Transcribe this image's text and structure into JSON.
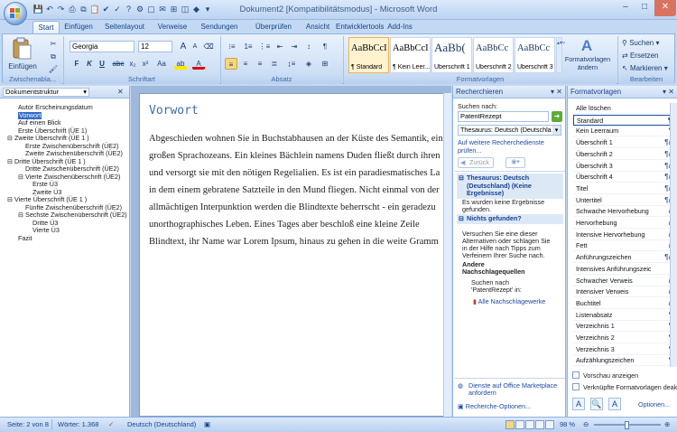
{
  "window": {
    "title": "Dokument2 [Kompatibilitätsmodus] - Microsoft Word",
    "minimize": "–",
    "maximize": "□",
    "close": "✕"
  },
  "qat": [
    "save-icon",
    "undo-icon",
    "redo-icon",
    "print-icon",
    "copy-icon",
    "paste-icon",
    "check-icon",
    "spell-icon",
    "help-icon",
    "format-icon",
    "new-icon",
    "mail-icon",
    "table-icon",
    "preview-icon",
    "misc-icon",
    "more-icon"
  ],
  "tabs": [
    "Start",
    "Einfügen",
    "Seitenlayout",
    "Verweise",
    "Sendungen",
    "Überprüfen",
    "Ansicht",
    "Entwicklertools",
    "Add-Ins"
  ],
  "ribbon": {
    "clipboard": {
      "paste": "Einfügen",
      "label": "Zwischenabla..."
    },
    "font": {
      "name": "Georgia",
      "size": "12",
      "label": "Schriftart",
      "bold": "F",
      "italic": "K",
      "underline": "U",
      "strike": "abc",
      "sub": "x₂",
      "sup": "x²",
      "case": "Aa",
      "grow": "A",
      "shrink": "A",
      "clear": "⌫"
    },
    "paragraph": {
      "label": "Absatz"
    },
    "styles": {
      "label": "Formatvorlagen",
      "items": [
        {
          "sample": "AaBbCcI",
          "name": "¶ Standard"
        },
        {
          "sample": "AaBbCcI",
          "name": "¶ Kein Leer..."
        },
        {
          "sample": "AaBb(",
          "name": "Überschrift 1"
        },
        {
          "sample": "AaBbCc",
          "name": "Überschrift 2"
        },
        {
          "sample": "AaBbCc",
          "name": "Überschrift 3"
        }
      ],
      "change": "Formatvorlagen ändern"
    },
    "edit": {
      "label": "Bearbeiten",
      "search": "Suchen",
      "replace": "Ersetzen",
      "mark": "Markieren"
    }
  },
  "docstruct": {
    "title": "Dokumentstruktur",
    "items": [
      {
        "t": "Autor Erscheinungsdatum"
      },
      {
        "t": "Vorwort",
        "sel": true
      },
      {
        "t": "Auf einen Blick"
      },
      {
        "t": "Erste Überschrift (ÜE 1)"
      },
      {
        "t": "⊟ Zweite Überschrift (ÜE 1 )"
      },
      {
        "t": "Erste Zwischenüberschrift (ÜE2)"
      },
      {
        "t": "Zweite Zwischenüberschrift (ÜE2)"
      },
      {
        "t": "⊟ Dritte Überschrift (ÜE 1 )"
      },
      {
        "t": "Dritte Zwischenüberschrift (ÜE2)"
      },
      {
        "t": "⊟ Vierte Zwischenüberschrift (ÜE2)"
      },
      {
        "t": "Erste Ü3"
      },
      {
        "t": "Zweite Ü3"
      },
      {
        "t": "⊟ Vierte Überschrift (ÜE 1 )"
      },
      {
        "t": "Fünfte Zwischenüberschrift (ÜE2)"
      },
      {
        "t": "⊟ Sechste Zwischenüberschrift (ÜE2)"
      },
      {
        "t": "Dritte Ü3"
      },
      {
        "t": "Vierte Ü3"
      },
      {
        "t": "Fazit"
      }
    ]
  },
  "document": {
    "heading": "Vorwort",
    "lines": [
      "Abgeschieden wohnen Sie in Buchstabhausen an der Küste des Semantik, ein",
      "großen Sprachozeans. Ein kleines Bächlein namens Duden fließt durch ihren",
      "und versorgt sie mit den nötigen Regelialien. Es ist ein paradiesmatisches La",
      "in dem einem gebratene Satzteile in den Mund fliegen. Nicht einmal von der",
      "allmächtigen Interpunktion werden die Blindtexte beherrscht - ein geradezu",
      "unorthographisches Leben. Eines Tages aber beschloß eine kleine Zeile",
      "Blindtext, ihr Name war Lorem Ipsum, hinaus zu gehen in die weite Gramm"
    ]
  },
  "research": {
    "title": "Recherchieren",
    "search_label": "Suchen nach:",
    "query": "PatentRezept",
    "source": "Thesaurus: Deutsch (Deutschla",
    "more": "Auf weitere Recherchedienste prüfen...",
    "back": "Zurück",
    "thes_head": "Thesaurus: Deutsch (Deutschland) (Keine Ergebnisse)",
    "thes_body": [
      "Es wurden keine Ergebnisse",
      "gefunden."
    ],
    "nf_head": "Nichts gefunden?",
    "nf_body": [
      "Versuchen Sie eine dieser",
      "Alternativen oder schlagen Sie",
      "in der Hilfe nach Tipps zum",
      "Verfeinern Ihrer Suche nach."
    ],
    "other_head": [
      "Andere",
      "Nachschlagequellen"
    ],
    "search_for": [
      "Suchen nach",
      "'PatentRezept' in:"
    ],
    "all": "Alle Nachschlagewerke",
    "market": [
      "Dienste auf Office Marketplace",
      "anfordern"
    ],
    "options": "Recherche-Optionen..."
  },
  "format": {
    "title": "Formatvorlagen",
    "items": [
      {
        "n": "Alle löschen",
        "s": ""
      },
      {
        "n": "Standard",
        "s": "¶",
        "sel": true
      },
      {
        "n": "Kein Leerraum",
        "s": "¶"
      },
      {
        "n": "Überschrift 1",
        "s": "¶a"
      },
      {
        "n": "Überschrift 2",
        "s": "¶a"
      },
      {
        "n": "Überschrift 3",
        "s": "¶a"
      },
      {
        "n": "Überschrift 4",
        "s": "¶a"
      },
      {
        "n": "Titel",
        "s": "¶a"
      },
      {
        "n": "Untertitel",
        "s": "¶a"
      },
      {
        "n": "Schwache Hervorhebung",
        "s": "a"
      },
      {
        "n": "Hervorhebung",
        "s": "a"
      },
      {
        "n": "Intensive Hervorhebung",
        "s": "a"
      },
      {
        "n": "Fett",
        "s": "a"
      },
      {
        "n": "Anführungszeichen",
        "s": "¶a"
      },
      {
        "n": "Intensives Anführungszeic",
        "s": ""
      },
      {
        "n": "Schwacher Verweis",
        "s": "a"
      },
      {
        "n": "Intensiver Verweis",
        "s": "a"
      },
      {
        "n": "Buchtitel",
        "s": "a"
      },
      {
        "n": "Listenabsatz",
        "s": "¶"
      },
      {
        "n": "Verzeichnis 1",
        "s": "¶"
      },
      {
        "n": "Verzeichnis 2",
        "s": "¶"
      },
      {
        "n": "Verzeichnis 3",
        "s": "¶"
      },
      {
        "n": "Aufzählungszeichen",
        "s": "¶"
      }
    ],
    "preview": "Vorschau anzeigen",
    "linked": "Verknüpfte Formatvorlagen deakt",
    "options": "Optionen..."
  },
  "status": {
    "page": "Seite: 2 von 8",
    "words": "Wörter: 1.368",
    "lang": "Deutsch (Deutschland)",
    "zoom": "98 %"
  },
  "colors": {
    "accent": "#15428b",
    "ribbon": "#d0e1f6"
  }
}
